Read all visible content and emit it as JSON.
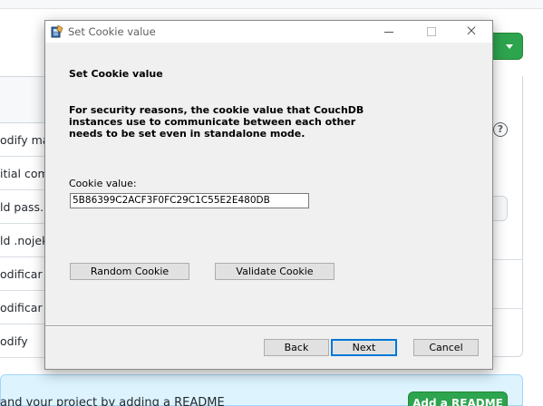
{
  "background": {
    "commit_rows": [
      "odify ma",
      "itial com",
      "ld pass.h",
      "ld .nojek",
      "odificar",
      "odificar",
      "odify"
    ],
    "readme_text": "and your project by adding a README",
    "readme_button": "Add a README",
    "help_icon_glyph": "?"
  },
  "dialog": {
    "title": "Set Cookie value",
    "icon": "installer-icon",
    "window_controls": {
      "minimize": "minimize-icon",
      "maximize": "maximize-icon",
      "close": "×"
    },
    "heading": "Set Cookie value",
    "description_lines": [
      "For security reasons, the cookie value that CouchDB",
      "instances use to communicate between each other",
      "needs to be set even in standalone mode."
    ],
    "cookie_label": "Cookie value:",
    "cookie_value": "5B86399C2ACF3F0FC29C1C55E2E480DB",
    "random_button": "Random Cookie",
    "validate_button": "Validate Cookie",
    "back_button": "Back",
    "next_button": "Next",
    "cancel_button": "Cancel"
  },
  "colors": {
    "dialog_bg": "#f0f0f0",
    "focus_border": "#0078d7",
    "github_green": "#2da44e",
    "readme_banner": "#ddf4ff"
  }
}
